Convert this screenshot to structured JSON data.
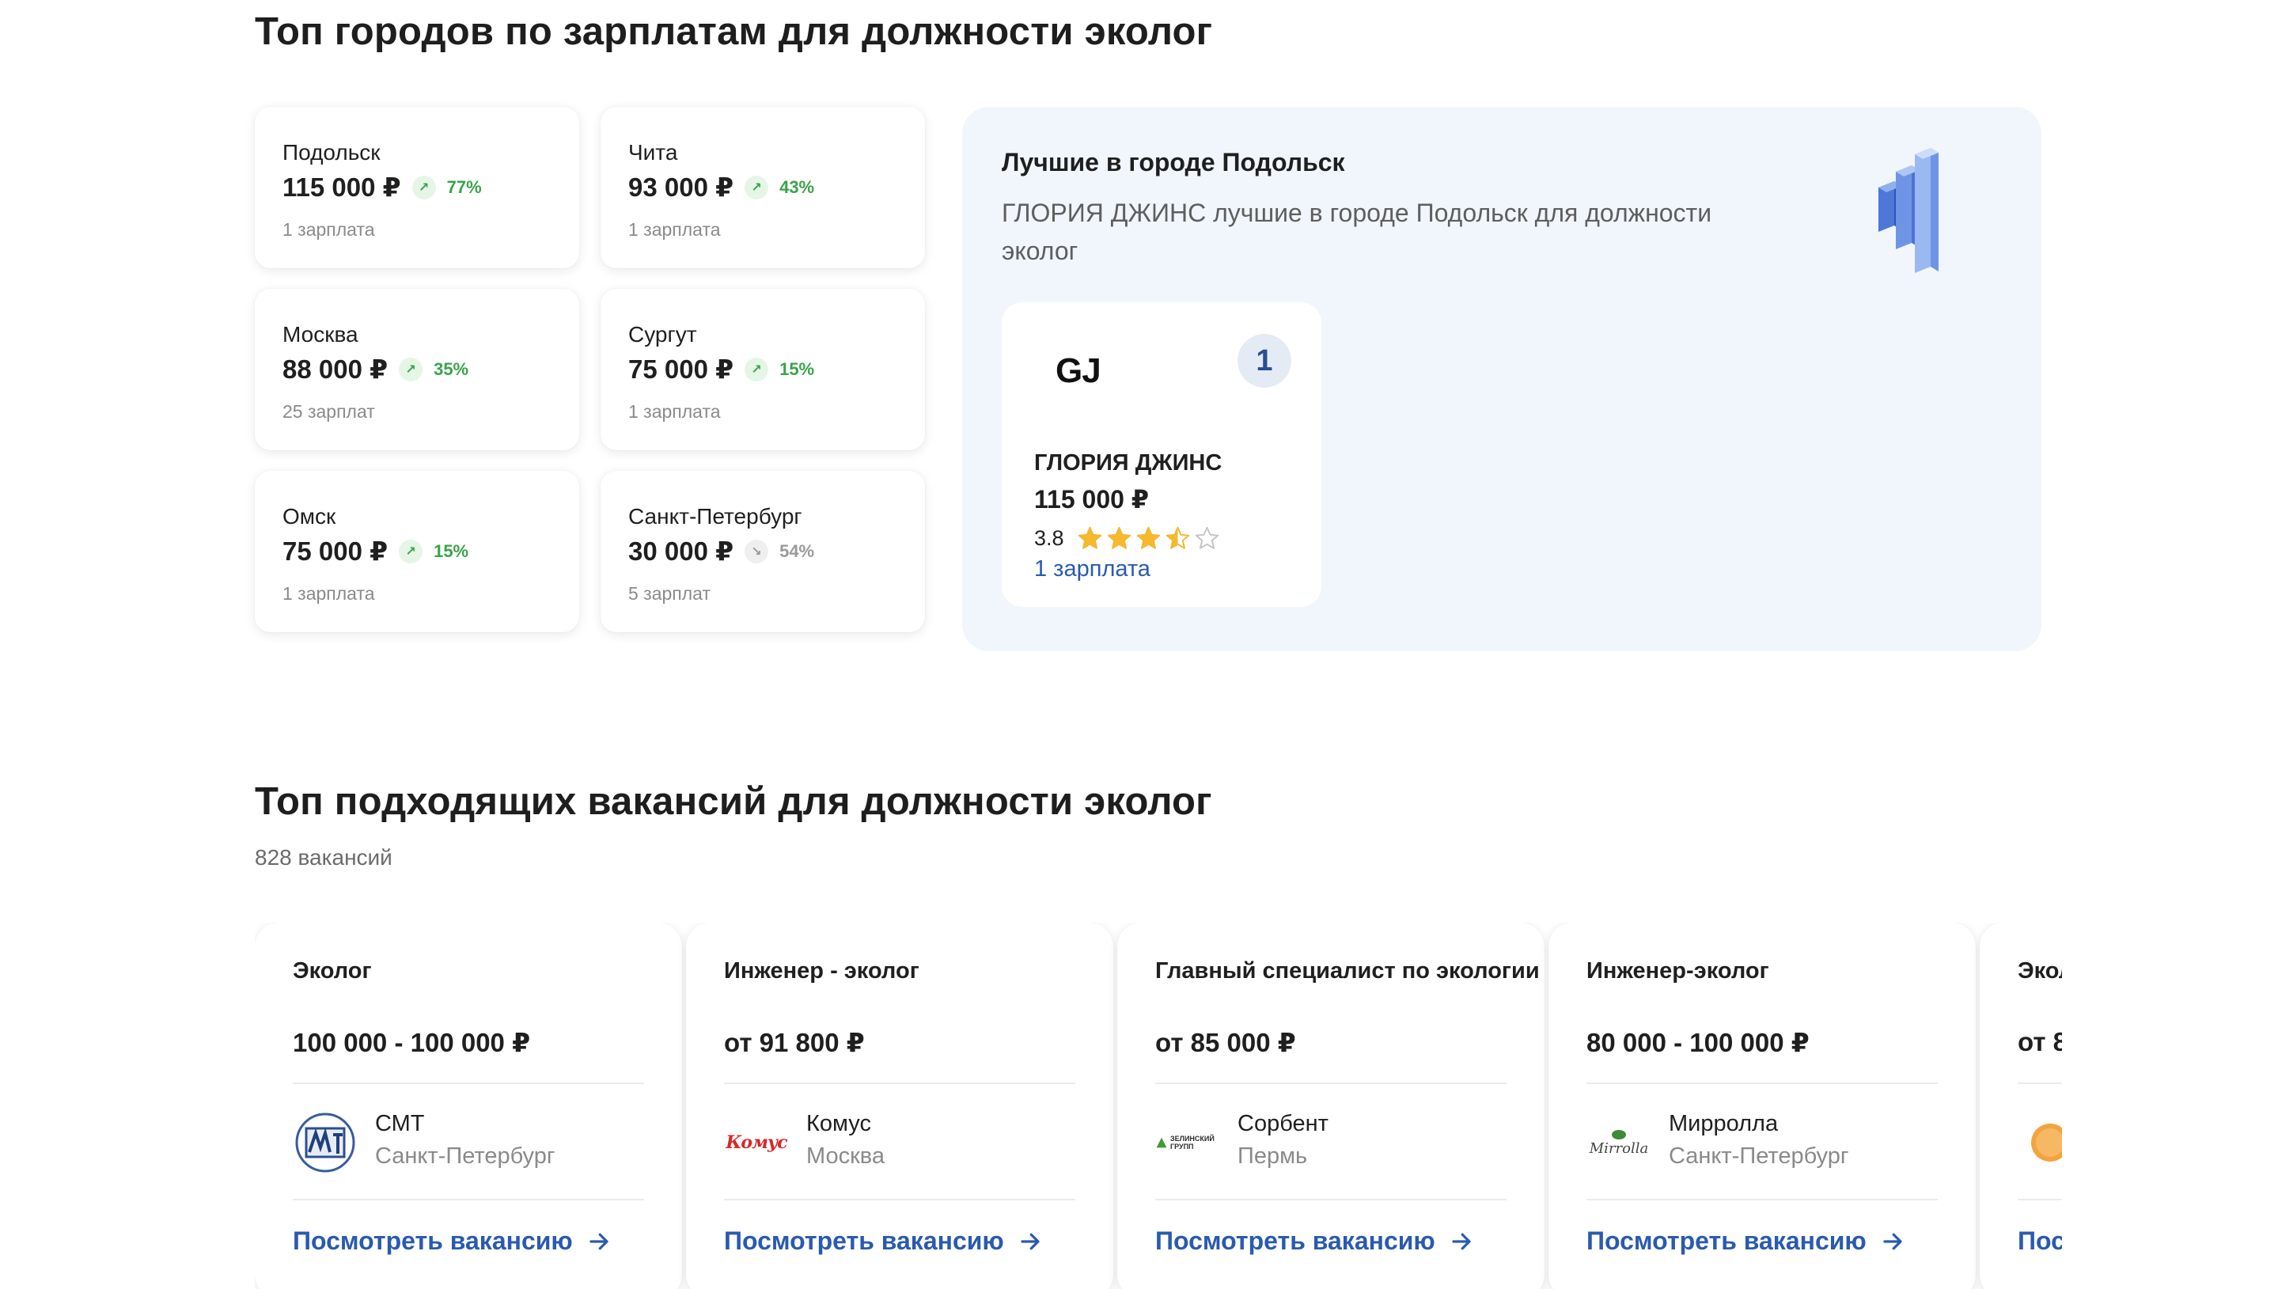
{
  "top_cities": {
    "title": "Топ городов по зарплатам для должности эколог",
    "cities": [
      {
        "name": "Подольск",
        "salary": "115 000 ₽",
        "trend": "up",
        "pct": "77%",
        "count": "1 зарплата"
      },
      {
        "name": "Чита",
        "salary": "93 000 ₽",
        "trend": "up",
        "pct": "43%",
        "count": "1 зарплата"
      },
      {
        "name": "Москва",
        "salary": "88 000 ₽",
        "trend": "up",
        "pct": "35%",
        "count": "25 зарплат"
      },
      {
        "name": "Сургут",
        "salary": "75 000 ₽",
        "trend": "up",
        "pct": "15%",
        "count": "1 зарплата"
      },
      {
        "name": "Омск",
        "salary": "75 000 ₽",
        "trend": "up",
        "pct": "15%",
        "count": "1 зарплата"
      },
      {
        "name": "Санкт-Петербург",
        "salary": "30 000 ₽",
        "trend": "down",
        "pct": "54%",
        "count": "5 зарплат"
      }
    ],
    "trend_up_glyph": "↗",
    "trend_down_glyph": "↘"
  },
  "best_in_city": {
    "title": "Лучшие в городе Подольск",
    "description": "ГЛОРИЯ ДЖИНС лучшие в городе Подольск для должности эколог",
    "icon": "bar-chart-icon",
    "company": {
      "logo_text": "GJ",
      "rank": "1",
      "name": "ГЛОРИЯ ДЖИНС",
      "salary": "115 000 ₽",
      "rating": "3.8",
      "rating_value": 3.5,
      "salaries_link": "1 зарплата"
    }
  },
  "top_vacancies": {
    "title": "Топ подходящих вакансий для должности эколог",
    "count": "828 вакансий",
    "link_label": "Посмотреть вакансию",
    "items": [
      {
        "title": "Эколог",
        "salary": "100 000 - 100 000 ₽",
        "company": "СМТ",
        "city": "Санкт-Петербург",
        "logo": "smt-logo"
      },
      {
        "title": "Инженер - эколог",
        "salary": "от 91 800 ₽",
        "company": "Комус",
        "city": "Москва",
        "logo": "komus-logo",
        "logo_text": "Комус"
      },
      {
        "title": "Главный специалист по экологии",
        "salary": "от 85 000 ₽",
        "company": "Сорбент",
        "city": "Пермь",
        "logo": "sorbent-logo",
        "logo_text": "ЗЕЛИНСКИЙ ГРУПП"
      },
      {
        "title": "Инженер-эколог",
        "salary": "80 000 - 100 000 ₽",
        "company": "Мирролла",
        "city": "Санкт-Петербург",
        "logo": "mirrolla-logo",
        "logo_text": "Mirrolla"
      },
      {
        "title": "Эколог",
        "salary": "от 8",
        "company": "",
        "city": "",
        "logo": "orange-logo"
      }
    ]
  },
  "colors": {
    "accent_blue": "#2a5ab0",
    "trend_green": "#3aa34a",
    "star_gold": "#f5b82e",
    "panel_bg": "#f1f6fd"
  }
}
